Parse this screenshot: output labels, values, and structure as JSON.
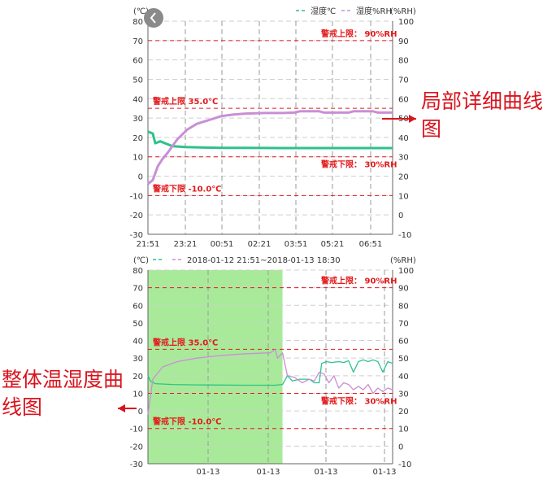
{
  "annotations": {
    "detail": "局部详细曲线图",
    "overall": "整体温湿度曲线图"
  },
  "colors": {
    "temperature": "#2dc28a",
    "humidity": "#c98fd6",
    "alarm": "#e31a1c",
    "selection": "#9fe88e",
    "annotation": "#d9141e"
  },
  "chart_data": [
    {
      "type": "line",
      "id": "detail",
      "left_axis_unit": "(℃)",
      "right_axis_unit": "(%RH)",
      "legend": [
        "湿度℃",
        "湿度%RH"
      ],
      "x_tick_labels": [
        "21:51",
        "23:21",
        "00:51",
        "02:21",
        "03:51",
        "05:21",
        "06:51"
      ],
      "ylim": [
        -30,
        80
      ],
      "y2lim": [
        -10,
        100
      ],
      "y_ticks": [
        80,
        70,
        60,
        50,
        40,
        30,
        20,
        10,
        0,
        -10,
        -20,
        -30
      ],
      "y2_ticks": [
        100,
        90,
        80,
        70,
        60,
        50,
        40,
        30,
        20,
        10,
        0,
        -10
      ],
      "grid": true,
      "alarm_lines": [
        {
          "axis": "right",
          "value": 90,
          "label": "警戒上限： 90%RH"
        },
        {
          "axis": "left",
          "value": 35,
          "label": "警戒上限 35.0℃"
        },
        {
          "axis": "right",
          "value": 30,
          "label": "警戒下限： 30%RH"
        },
        {
          "axis": "left",
          "value": -10,
          "label": "警戒下限 -10.0℃"
        }
      ],
      "series": [
        {
          "name": "湿度℃",
          "axis": "left",
          "points": [
            [
              0,
              23
            ],
            [
              2,
              22
            ],
            [
              3,
              17
            ],
            [
              5,
              18
            ],
            [
              7,
              17
            ],
            [
              10,
              15.5
            ],
            [
              15,
              15
            ],
            [
              22,
              14.8
            ],
            [
              30,
              14.6
            ],
            [
              40,
              14.6
            ],
            [
              55,
              14.5
            ],
            [
              70,
              14.5
            ],
            [
              85,
              14.5
            ],
            [
              100,
              14.5
            ]
          ]
        },
        {
          "name": "湿度%RH",
          "axis": "right",
          "points": [
            [
              0,
              16
            ],
            [
              2,
              18
            ],
            [
              4,
              25
            ],
            [
              6,
              29
            ],
            [
              8,
              32
            ],
            [
              12,
              39
            ],
            [
              16,
              44
            ],
            [
              20,
              47
            ],
            [
              25,
              49
            ],
            [
              30,
              51
            ],
            [
              35,
              51.8
            ],
            [
              40,
              52.3
            ],
            [
              48,
              52.6
            ],
            [
              55,
              52.6
            ],
            [
              60,
              52.8
            ],
            [
              62,
              53.5
            ],
            [
              70,
              53.5
            ],
            [
              72,
              52.8
            ],
            [
              82,
              52.8
            ],
            [
              84,
              53.5
            ],
            [
              92,
              53.5
            ],
            [
              94,
              52.8
            ],
            [
              100,
              52.8
            ]
          ]
        }
      ]
    },
    {
      "type": "line",
      "id": "overall",
      "left_axis_unit": "(℃)",
      "right_axis_unit": "(%RH)",
      "legend_range": "2018-01-12 21:51~2018-01-13 18:30",
      "x_tick_labels": [
        "01-13",
        "01-13",
        "01-13",
        "01-13"
      ],
      "ylim": [
        -30,
        80
      ],
      "y2lim": [
        -10,
        100
      ],
      "y_ticks": [
        80,
        70,
        60,
        50,
        40,
        30,
        20,
        10,
        0,
        -10,
        -20,
        -30
      ],
      "y2_ticks": [
        100,
        90,
        80,
        70,
        60,
        50,
        40,
        30,
        20,
        10,
        0,
        -10
      ],
      "grid": true,
      "selection": [
        0,
        55
      ],
      "alarm_lines": [
        {
          "axis": "right",
          "value": 90,
          "label": "警戒上限： 90%RH"
        },
        {
          "axis": "left",
          "value": 35,
          "label": "警戒上限 35.0℃"
        },
        {
          "axis": "right",
          "value": 30,
          "label": "警戒下限： 30%RH"
        },
        {
          "axis": "left",
          "value": -10,
          "label": "警戒下限 -10.0℃"
        }
      ],
      "series": [
        {
          "name": "湿度℃",
          "axis": "left",
          "points": [
            [
              0,
              20
            ],
            [
              1,
              17
            ],
            [
              3,
              15.5
            ],
            [
              10,
              15
            ],
            [
              20,
              14.8
            ],
            [
              40,
              14.6
            ],
            [
              52,
              14.6
            ],
            [
              55,
              15
            ],
            [
              57,
              20
            ],
            [
              59,
              17
            ],
            [
              62,
              18
            ],
            [
              66,
              18
            ],
            [
              68,
              16
            ],
            [
              70,
              16
            ],
            [
              71,
              27
            ],
            [
              73,
              28
            ],
            [
              75,
              27.5
            ],
            [
              78,
              28
            ],
            [
              80,
              27.5
            ],
            [
              82,
              28.5
            ],
            [
              84,
              22
            ],
            [
              86,
              28
            ],
            [
              88,
              29
            ],
            [
              90,
              28
            ],
            [
              92,
              29
            ],
            [
              94,
              28
            ],
            [
              96,
              22
            ],
            [
              98,
              28
            ],
            [
              100,
              27
            ]
          ]
        },
        {
          "name": "湿度%RH",
          "axis": "right",
          "points": [
            [
              0,
              18
            ],
            [
              2,
              38
            ],
            [
              6,
              45
            ],
            [
              12,
              48
            ],
            [
              20,
              50
            ],
            [
              30,
              51.5
            ],
            [
              40,
              52.5
            ],
            [
              50,
              53
            ],
            [
              52,
              55
            ],
            [
              53,
              50
            ],
            [
              55,
              53
            ],
            [
              57,
              40
            ],
            [
              60,
              39
            ],
            [
              63,
              36
            ],
            [
              66,
              38
            ],
            [
              68,
              37
            ],
            [
              70,
              42
            ],
            [
              72,
              41
            ],
            [
              74,
              36
            ],
            [
              76,
              40
            ],
            [
              78,
              33
            ],
            [
              80,
              36
            ],
            [
              82,
              35
            ],
            [
              84,
              32
            ],
            [
              86,
              34
            ],
            [
              88,
              32
            ],
            [
              90,
              35
            ],
            [
              92,
              30
            ],
            [
              94,
              33
            ],
            [
              96,
              31
            ],
            [
              98,
              33
            ],
            [
              100,
              32
            ]
          ]
        }
      ]
    }
  ]
}
